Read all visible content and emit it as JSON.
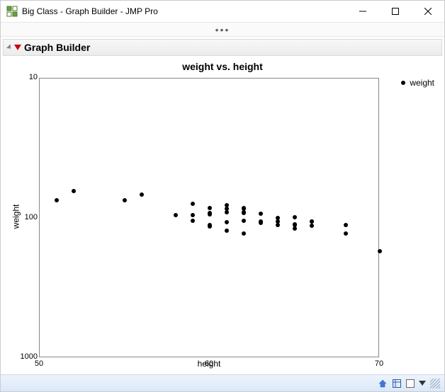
{
  "window": {
    "title": "Big Class - Graph Builder - JMP Pro"
  },
  "toolbar": {
    "overflow": "•••"
  },
  "section": {
    "title": "Graph Builder"
  },
  "legend": {
    "label": "weight"
  },
  "chart_data": {
    "type": "scatter",
    "title": "weight vs. height",
    "xlabel": "height",
    "ylabel": "weight",
    "xlim": [
      50,
      70
    ],
    "ylim_log": [
      10,
      1000
    ],
    "y_scale": "log_reversed",
    "x_ticks": [
      50,
      60,
      70
    ],
    "y_ticks": [
      10,
      100,
      1000
    ],
    "series": [
      {
        "name": "weight",
        "points": [
          {
            "x": 51,
            "y": 74
          },
          {
            "x": 52,
            "y": 64
          },
          {
            "x": 55,
            "y": 74
          },
          {
            "x": 56,
            "y": 68
          },
          {
            "x": 58,
            "y": 95
          },
          {
            "x": 59,
            "y": 79
          },
          {
            "x": 59,
            "y": 95
          },
          {
            "x": 59,
            "y": 104
          },
          {
            "x": 60,
            "y": 84
          },
          {
            "x": 60,
            "y": 92
          },
          {
            "x": 60,
            "y": 94
          },
          {
            "x": 60,
            "y": 112
          },
          {
            "x": 60,
            "y": 115
          },
          {
            "x": 61,
            "y": 81
          },
          {
            "x": 61,
            "y": 85
          },
          {
            "x": 61,
            "y": 91
          },
          {
            "x": 61,
            "y": 107
          },
          {
            "x": 61,
            "y": 123
          },
          {
            "x": 62,
            "y": 84
          },
          {
            "x": 62,
            "y": 85
          },
          {
            "x": 62,
            "y": 91
          },
          {
            "x": 62,
            "y": 92
          },
          {
            "x": 62,
            "y": 104
          },
          {
            "x": 62,
            "y": 128
          },
          {
            "x": 63,
            "y": 93
          },
          {
            "x": 63,
            "y": 105
          },
          {
            "x": 63,
            "y": 108
          },
          {
            "x": 64,
            "y": 99
          },
          {
            "x": 64,
            "y": 106
          },
          {
            "x": 64,
            "y": 112
          },
          {
            "x": 65,
            "y": 98
          },
          {
            "x": 65,
            "y": 111
          },
          {
            "x": 65,
            "y": 112
          },
          {
            "x": 65,
            "y": 119
          },
          {
            "x": 66,
            "y": 105
          },
          {
            "x": 66,
            "y": 106
          },
          {
            "x": 66,
            "y": 113
          },
          {
            "x": 68,
            "y": 112
          },
          {
            "x": 68,
            "y": 128
          },
          {
            "x": 70,
            "y": 172
          }
        ]
      }
    ]
  }
}
